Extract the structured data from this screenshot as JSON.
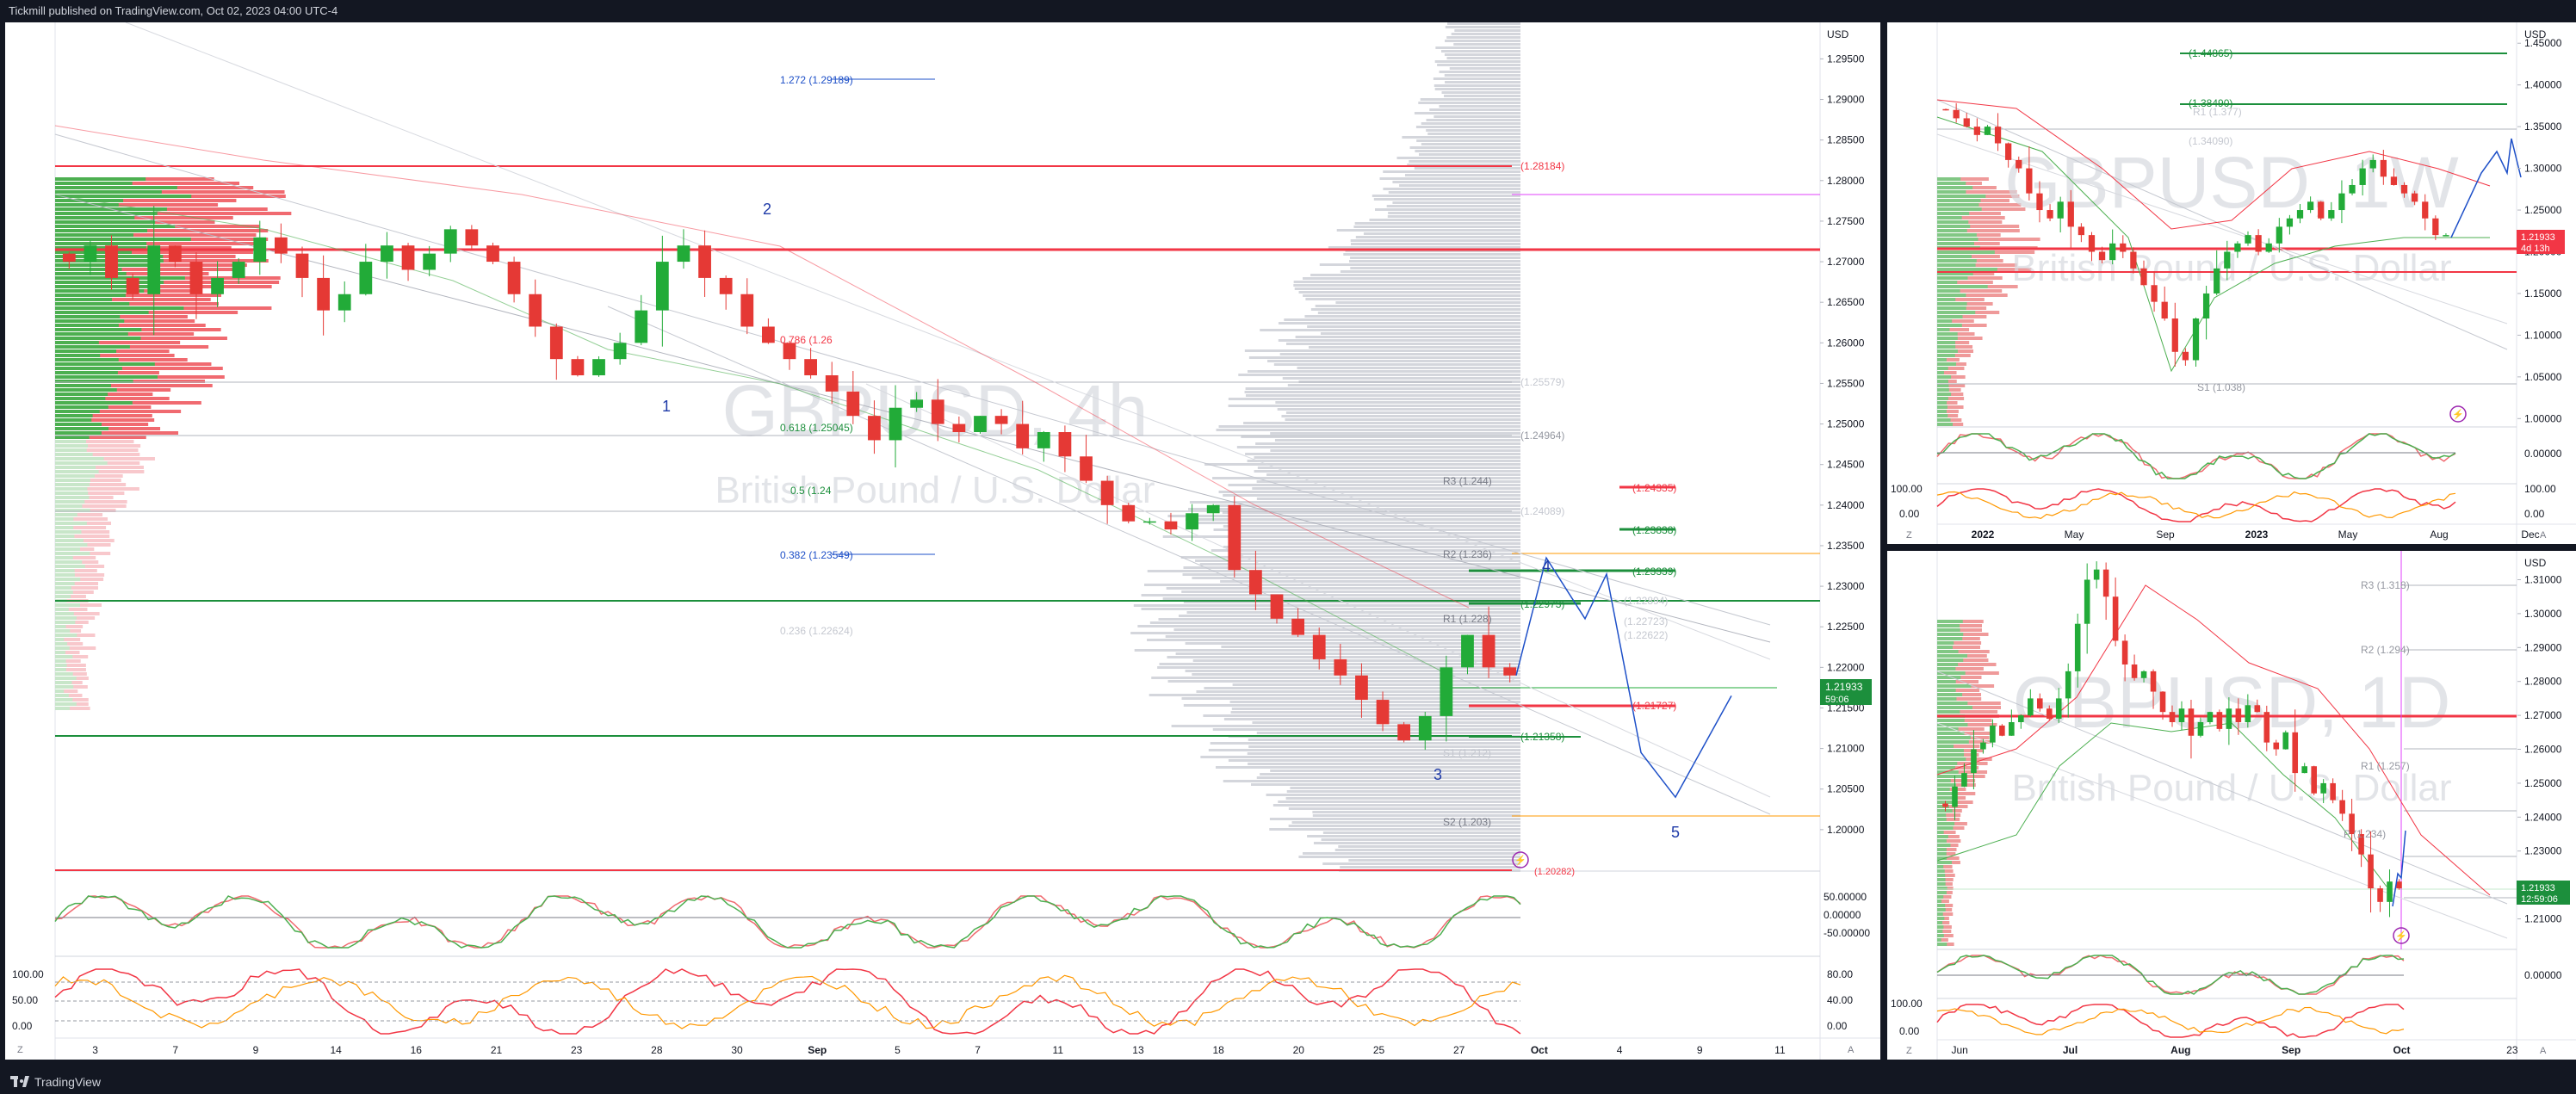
{
  "header": {
    "text": "Tickmill published on TradingView.com, Oct 02, 2023 04:00 UTC-4"
  },
  "footer": {
    "brand": "TradingView"
  },
  "colors": {
    "up": "#089981",
    "down": "#f23645",
    "green_candle": "#22ab38",
    "red_candle": "#e53935",
    "blue": "#1e50c8",
    "last_price": "#1c8f3c",
    "purple": "#9c27b0",
    "orange": "#ff9800"
  },
  "main": {
    "watermark_symbol": "GBPUSD, 4h",
    "watermark_name": "British Pound / U.S. Dollar",
    "currency": "USD",
    "price_ticks": [
      "1.29500",
      "1.29000",
      "1.28500",
      "1.28000",
      "1.27500",
      "1.27000",
      "1.26500",
      "1.26000",
      "1.25500",
      "1.25000",
      "1.24500",
      "1.24000",
      "1.23500",
      "1.23000",
      "1.22500",
      "1.22000",
      "1.21500",
      "1.21000",
      "1.20500",
      "1.20000"
    ],
    "last_price": "1.21933",
    "countdown": "59:06",
    "date_ticks": [
      "3",
      "7",
      "9",
      "14",
      "16",
      "21",
      "23",
      "28",
      "30",
      "Sep",
      "5",
      "7",
      "11",
      "13",
      "18",
      "20",
      "25",
      "27",
      "Oct",
      "4",
      "9",
      "11"
    ],
    "fib_labels": [
      "1.272 (1.29189)",
      "0.786 (1.26",
      "0.618 (1.25045)",
      "0.5 (1.24",
      "0.382 (1.23549)",
      "0.236 (1.22624)"
    ],
    "level_labels": [
      "(1.28184)",
      "(1.25579)",
      "(1.24964)",
      "(1.24335)",
      "(1.24089)",
      "(1.23838)",
      "(1.23339)",
      "(1.22973)",
      "(1.22894)",
      "(1.22723)",
      "(1.22622)",
      "(1.21727)",
      "(1.21358)",
      "(1.20282)"
    ],
    "pivot_labels": [
      "R3 (1.244)",
      "R2 (1.236)",
      "R1 (1.228)",
      "S1 (1.212)",
      "S2 (1.203)"
    ],
    "wave_labels": [
      "1",
      "2",
      "3",
      "4",
      "5"
    ],
    "osc1_ticks": [
      "50.00000",
      "0.00000",
      "-50.00000"
    ],
    "osc2_ticks": [
      "80.00",
      "40.00",
      "0.00"
    ],
    "osc2_left_ticks": [
      "100.00",
      "50.00",
      "0.00"
    ],
    "chart_data": {
      "type": "candlestick",
      "symbol": "GBPUSD",
      "timeframe": "4h",
      "ylim": [
        1.195,
        1.2995
      ],
      "close_series": [
        1.27,
        1.272,
        1.268,
        1.266,
        1.272,
        1.27,
        1.266,
        1.268,
        1.27,
        1.273,
        1.271,
        1.268,
        1.264,
        1.266,
        1.27,
        1.272,
        1.269,
        1.271,
        1.274,
        1.272,
        1.27,
        1.266,
        1.262,
        1.258,
        1.256,
        1.258,
        1.26,
        1.264,
        1.27,
        1.272,
        1.268,
        1.266,
        1.262,
        1.26,
        1.258,
        1.256,
        1.254,
        1.251,
        1.248,
        1.252,
        1.253,
        1.25,
        1.249,
        1.251,
        1.25,
        1.247,
        1.249,
        1.246,
        1.243,
        1.24,
        1.238,
        1.238,
        1.237,
        1.239,
        1.24,
        1.232,
        1.229,
        1.226,
        1.224,
        1.221,
        1.219,
        1.216,
        1.213,
        1.211,
        1.214,
        1.22,
        1.224,
        1.22,
        1.219
      ],
      "projection": [
        [
          1.219,
          1.2335
        ],
        [
          1.2335,
          1.226
        ],
        [
          1.226,
          1.2315
        ],
        [
          1.2315,
          1.2095
        ],
        [
          1.2095,
          1.204
        ],
        [
          1.204,
          1.2165
        ]
      ]
    }
  },
  "weekly": {
    "watermark_symbol": "GBPUSD, 1W",
    "watermark_name": "British Pound / U.S. Dollar",
    "currency": "USD",
    "price_ticks": [
      "1.45000",
      "1.40000",
      "1.35000",
      "1.30000",
      "1.25000",
      "1.20000",
      "1.15000",
      "1.10000",
      "1.05000",
      "1.00000"
    ],
    "last_price": "1.21933",
    "countdown": "4d 13h",
    "date_ticks": [
      "2022",
      "May",
      "Sep",
      "2023",
      "May",
      "Aug",
      "Dec"
    ],
    "level_labels": [
      "(1.44865)",
      "(1.38490)",
      "R1 (1.377)",
      "(1.34090)",
      "S1 (1.038)"
    ],
    "osc1_ticks": [
      "0.00000"
    ],
    "osc2_ticks": [
      "100.00",
      "0.00"
    ],
    "chart_data": {
      "type": "candlestick",
      "symbol": "GBPUSD",
      "timeframe": "1W",
      "ylim": [
        0.99,
        1.475
      ],
      "close_series": [
        1.37,
        1.36,
        1.35,
        1.34,
        1.35,
        1.33,
        1.31,
        1.3,
        1.27,
        1.25,
        1.24,
        1.26,
        1.23,
        1.22,
        1.2,
        1.19,
        1.21,
        1.2,
        1.18,
        1.16,
        1.14,
        1.12,
        1.08,
        1.07,
        1.12,
        1.15,
        1.18,
        1.2,
        1.21,
        1.22,
        1.2,
        1.21,
        1.23,
        1.24,
        1.25,
        1.26,
        1.24,
        1.25,
        1.27,
        1.28,
        1.3,
        1.31,
        1.29,
        1.28,
        1.27,
        1.26,
        1.24,
        1.22,
        1.22
      ]
    }
  },
  "daily": {
    "watermark_symbol": "GBPUSD, 1D",
    "watermark_name": "British Pound / U.S. Dollar",
    "currency": "USD",
    "price_ticks": [
      "1.31000",
      "1.30000",
      "1.29000",
      "1.28000",
      "1.27000",
      "1.26000",
      "1.25000",
      "1.24000",
      "1.23000",
      "1.22000",
      "1.21000"
    ],
    "last_price": "1.21933",
    "countdown": "12:59:06",
    "date_ticks": [
      "Jun",
      "Jul",
      "Aug",
      "Sep",
      "Oct",
      "23"
    ],
    "level_labels": [
      "R3 (1.318)",
      "R2 (1.294)",
      "R1 (1.257)",
      "P (1.234)"
    ],
    "osc1_ticks": [
      "0.00000"
    ],
    "osc2_ticks": [
      "100.00",
      "0.00"
    ],
    "chart_data": {
      "type": "candlestick",
      "symbol": "GBPUSD",
      "timeframe": "1D",
      "ylim": [
        1.201,
        1.3185
      ],
      "close_series": [
        1.243,
        1.249,
        1.253,
        1.26,
        1.262,
        1.267,
        1.264,
        1.268,
        1.27,
        1.275,
        1.272,
        1.269,
        1.275,
        1.283,
        1.297,
        1.31,
        1.313,
        1.305,
        1.292,
        1.285,
        1.281,
        1.283,
        1.277,
        1.271,
        1.268,
        1.272,
        1.264,
        1.268,
        1.271,
        1.266,
        1.272,
        1.268,
        1.273,
        1.271,
        1.262,
        1.26,
        1.265,
        1.253,
        1.255,
        1.247,
        1.25,
        1.245,
        1.241,
        1.235,
        1.229,
        1.219,
        1.215,
        1.221,
        1.219
      ]
    }
  }
}
